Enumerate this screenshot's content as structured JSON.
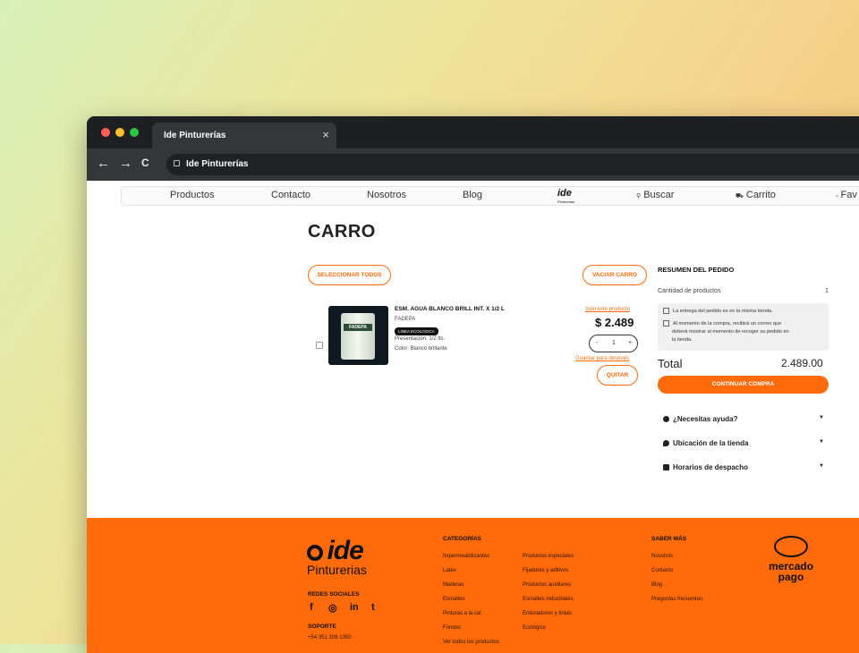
{
  "browser": {
    "tab_title": "Ide Pinturerías",
    "close_glyph": "×",
    "address": "Ide Pinturerías",
    "back": "←",
    "forward": "→",
    "reload": "C"
  },
  "site_nav": {
    "items": [
      "Productos",
      "Contacto",
      "Nosotros",
      "Blog"
    ],
    "logo_text": "ide",
    "logo_sub": "Pinturerias",
    "search": "Buscar",
    "cart": "Carrito",
    "favorites": "Fav"
  },
  "cart": {
    "title": "CARRO",
    "select_all": "SELECCIONAR TODOS",
    "empty_cart": "VACIAR CARRO",
    "item": {
      "name": "ESM. AGUA BLANCO BRILL INT. X 1/2 L",
      "brand": "FADEPA",
      "badge": "LINEA ECOLOGICA",
      "presentation": "Presentación: 1/2 lts.",
      "color": "Color: Blanco brillante",
      "only_this": "Solo este producto",
      "price": "$ 2.489",
      "qty_minus": "-",
      "qty": "1",
      "qty_plus": "+",
      "save_later": "Guardar para después",
      "remove": "QUITAR",
      "image_label": "FADEPA"
    }
  },
  "summary": {
    "title": "RESUMEN DEL PEDIDO",
    "qty_label": "Cantidad de productos",
    "qty_value": "1",
    "info_1": "La entrega del pedido es en la misma tienda.",
    "info_2a": "Al momento de la compra, recibirá un correo que",
    "info_2b": "deberá mostrar al momento de recoger su pedido en",
    "info_2c": "la tienda.",
    "total_label": "Total",
    "total_value": "2.489.00",
    "cta": "CONTINUAR COMPRA",
    "accordions": [
      "¿Necesitas ayuda?",
      "Ubicación de la tienda",
      "Horarios de despacho"
    ]
  },
  "footer": {
    "logo_main": "ide",
    "logo_sub": "Pinturerias",
    "social_title": "REDES SOCIALES",
    "social_icons": [
      "f",
      "◎",
      "in",
      "t"
    ],
    "support_title": "SOPORTE",
    "support_phone": "+54 351 306 1350",
    "categories_title": "CATEGORÍAS",
    "categories_col1": [
      "Impermeabilizantes",
      "Latex",
      "Maderas",
      "Esmaltes",
      "Pinturas a la cal",
      "Fondos",
      "Ver todos los productos"
    ],
    "categories_col2": [
      "Productos especiales",
      "Fijadores y aditivos",
      "Productos auxiliares",
      "Esmaltes industriales",
      "Entonadores y tintas",
      "Ecológico"
    ],
    "more_title": "SABER MÁS",
    "more_links": [
      "Nosotros",
      "Contacto",
      "Blog",
      "Preguntas frecuentes"
    ],
    "mp_line1": "mercado",
    "mp_line2": "pago"
  },
  "colors": {
    "accent": "#ff6a0a",
    "dark": "#111111"
  }
}
